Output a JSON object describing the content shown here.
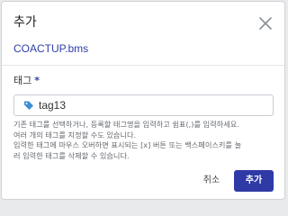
{
  "dialog": {
    "title": "추가",
    "filename": "COACTUP.bms",
    "close_icon": "close-icon"
  },
  "field": {
    "label": "태그",
    "required_marker": "*",
    "tag_value": "tag13",
    "tag_icon": "tag-icon"
  },
  "help": {
    "lines": [
      "기존 태그를 선택하거나, 등록할 태그명을 입력하고 쉼표(,)를 입력하세요.",
      "여러 개의 태그를 지정할 수도 있습니다.",
      "입력한 태그에 마우스 오버하면 표시되는 [x] 버튼 또는 백스페이스키를 눌",
      "러 입력한 태그를 삭제할 수 있습니다."
    ]
  },
  "buttons": {
    "cancel": "취소",
    "add": "추가"
  },
  "colors": {
    "accent": "#2f3aa6",
    "link": "#2f3ea8",
    "tag_icon": "#3a8fd6"
  }
}
